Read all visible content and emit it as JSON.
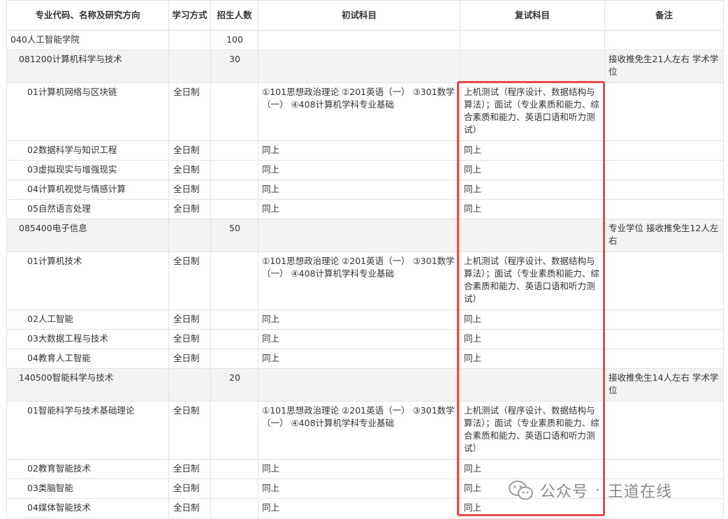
{
  "headers": [
    "专业代码、名称及研究方向",
    "学习方式",
    "招生人数",
    "初试科目",
    "复试科目",
    "备注"
  ],
  "school": {
    "name": "040人工智能学院",
    "count": "100"
  },
  "majors": [
    {
      "name": "081200计算机科学与技术",
      "count": "30",
      "note": "接收推免生21人左右 学术学位",
      "directions": [
        {
          "name": "01计算机网络与区块链",
          "mode": "全日制",
          "exam": "①101思想政治理论 ②201英语（一） ③301数学（一） ④408计算机学科专业基础",
          "retest": "上机测试（程序设计、数据结构与算法）；面试（专业素质和能力、综合素质和能力、英语口语和听力测试）"
        },
        {
          "name": "02数据科学与知识工程",
          "mode": "全日制",
          "exam": "同上",
          "retest": "同上"
        },
        {
          "name": "03虚拟现实与增强现实",
          "mode": "全日制",
          "exam": "同上",
          "retest": "同上"
        },
        {
          "name": "04计算机视觉与情感计算",
          "mode": "全日制",
          "exam": "同上",
          "retest": "同上"
        },
        {
          "name": "05自然语言处理",
          "mode": "全日制",
          "exam": "同上",
          "retest": "同上"
        }
      ]
    },
    {
      "name": "085400电子信息",
      "count": "50",
      "note": "专业学位 接收推免生12人左右",
      "directions": [
        {
          "name": "01计算机技术",
          "mode": "全日制",
          "exam": "①101思想政治理论 ②201英语（一） ③301数学（一） ④408计算机学科专业基础",
          "retest": "上机测试（程序设计、数据结构与算法）；面试（专业素质和能力、综合素质和能力、英语口语和听力测试）"
        },
        {
          "name": "02人工智能",
          "mode": "全日制",
          "exam": "同上",
          "retest": "同上"
        },
        {
          "name": "03大数据工程与技术",
          "mode": "全日制",
          "exam": "同上",
          "retest": "同上"
        },
        {
          "name": "04教育人工智能",
          "mode": "全日制",
          "exam": "同上",
          "retest": "同上"
        }
      ]
    },
    {
      "name": "140500智能科学与技术",
      "count": "20",
      "note": "接收推免生14人左右 学术学位",
      "directions": [
        {
          "name": "01智能科学与技术基础理论",
          "mode": "全日制",
          "exam": "①101思想政治理论 ②201英语（一） ③301数学（一） ④408计算机学科专业基础",
          "retest": "上机测试（程序设计、数据结构与算法）；面试（专业素质和能力、综合素质和能力、英语口语和听力测试）"
        },
        {
          "name": "02教育智能技术",
          "mode": "全日制",
          "exam": "同上",
          "retest": "同上"
        },
        {
          "name": "03类脑智能",
          "mode": "全日制",
          "exam": "同上",
          "retest": "同上"
        },
        {
          "name": "04媒体智能技术",
          "mode": "全日制",
          "exam": "同上",
          "retest": "同上"
        }
      ]
    }
  ],
  "watermark": {
    "icon": "wechat-icon",
    "source": "公众号",
    "separator": "·",
    "author": "王道在线"
  },
  "colors": {
    "highlight": "#e5484d",
    "major_row_bg": "#f3f3f3",
    "border": "#e3e3e3"
  }
}
